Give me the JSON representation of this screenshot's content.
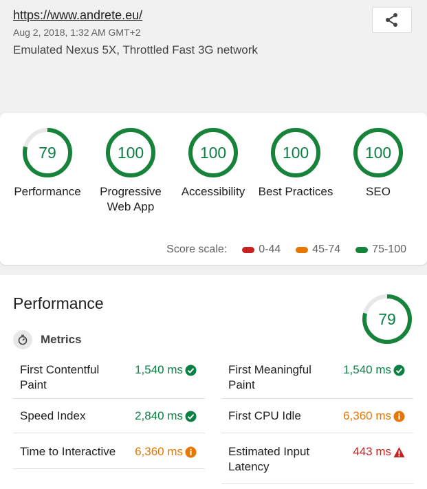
{
  "header": {
    "url": "https://www.andrete.eu/",
    "date": "Aug 2, 2018, 1:32 AM GMT+2",
    "environment": "Emulated Nexus 5X, Throttled Fast 3G network"
  },
  "categories": [
    {
      "score": "79",
      "label": "Performance",
      "value": 79
    },
    {
      "score": "100",
      "label": "Progressive\nWeb App",
      "value": 100
    },
    {
      "score": "100",
      "label": "Accessibility",
      "value": 100
    },
    {
      "score": "100",
      "label": "Best Practices",
      "value": 100
    },
    {
      "score": "100",
      "label": "SEO",
      "value": 100
    }
  ],
  "score_scale": {
    "label": "Score scale:",
    "ranges": [
      {
        "label": "0-44",
        "color": "#c7221f"
      },
      {
        "label": "45-74",
        "color": "#e67700"
      },
      {
        "label": "75-100",
        "color": "#178239"
      }
    ]
  },
  "colors": {
    "pass": "#0b8043",
    "average": "#e67700",
    "fail": "#c7221f"
  },
  "performance": {
    "title": "Performance",
    "score": "79",
    "value": 79,
    "metrics_label": "Metrics",
    "metrics": [
      {
        "name": "First Contentful\nPaint",
        "value": "1,540 ms",
        "status": "pass",
        "icon": "check-circle-icon"
      },
      {
        "name": "First Meaningful\nPaint",
        "value": "1,540 ms",
        "status": "pass",
        "icon": "check-circle-icon"
      },
      {
        "name": "Speed Index",
        "value": "2,840 ms",
        "status": "pass",
        "icon": "check-circle-icon"
      },
      {
        "name": "First CPU Idle",
        "value": "6,360 ms",
        "status": "average",
        "icon": "info-circle-icon"
      },
      {
        "name": "Time to Interactive",
        "value": "6,360 ms",
        "status": "average",
        "icon": "info-circle-icon"
      },
      {
        "name": "Estimated Input\nLatency",
        "value": "443 ms",
        "status": "fail",
        "icon": "warning-triangle-icon"
      }
    ]
  }
}
